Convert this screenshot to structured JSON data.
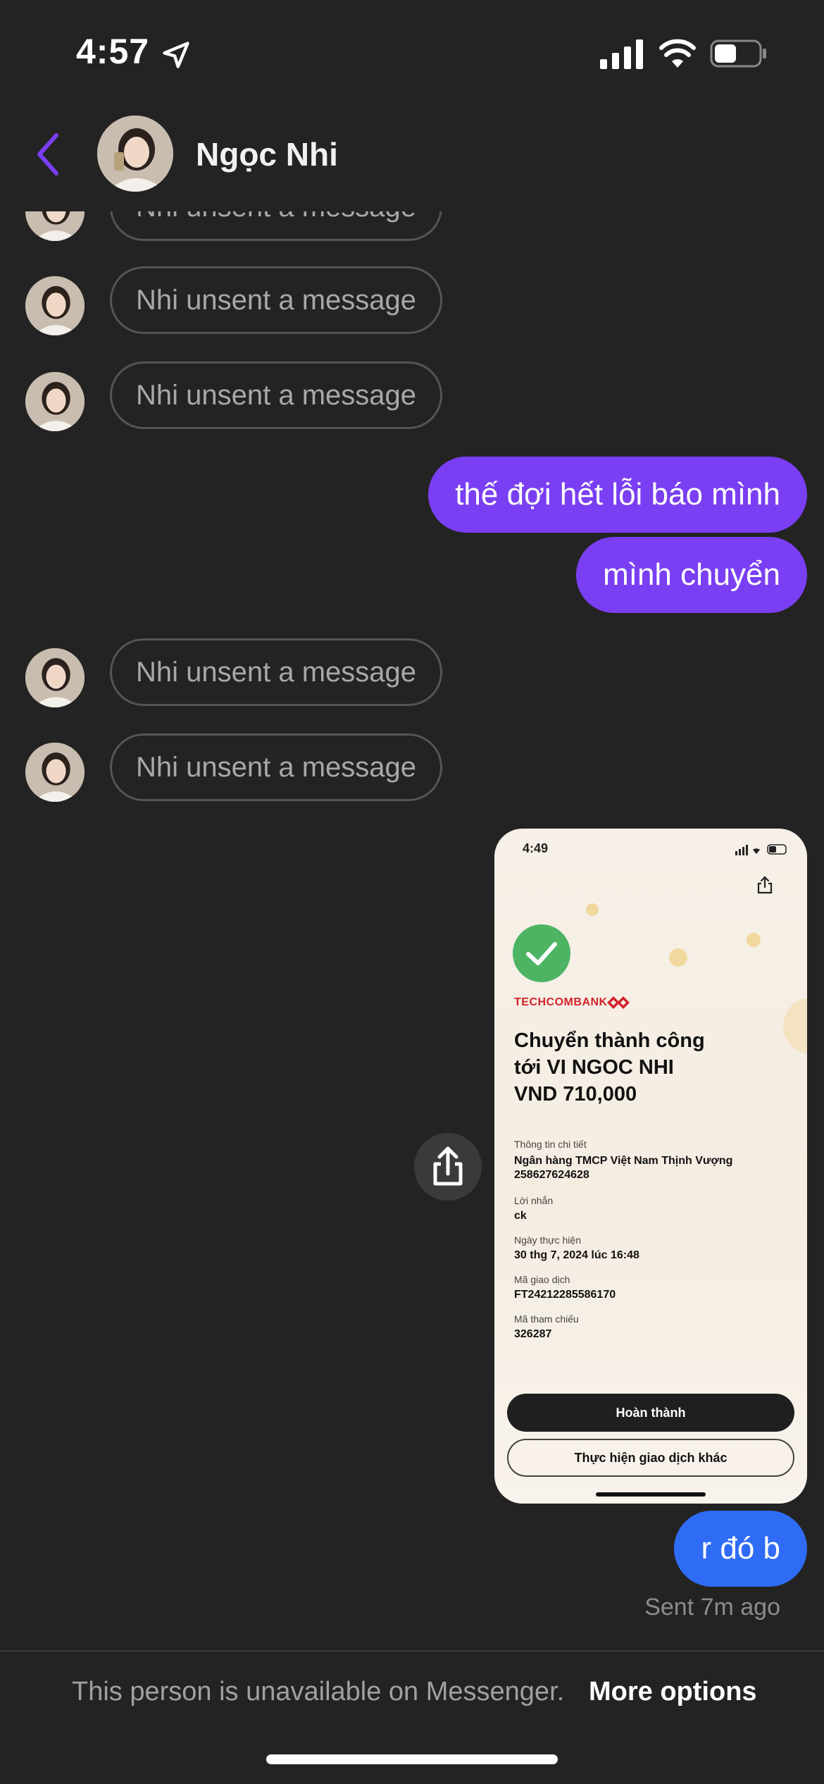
{
  "status_bar": {
    "time": "4:57"
  },
  "header": {
    "contact_name": "Ngọc Nhi"
  },
  "messages": {
    "unsent_text": "Nhi unsent a message",
    "outgoing_1": "thế đợi hết lỗi báo mình",
    "outgoing_2": "mình chuyển",
    "outgoing_3": "r đó b",
    "sent_status": "Sent 7m ago"
  },
  "receipt": {
    "time": "4:49",
    "bank": "TECHCOMBANK",
    "title_line1": "Chuyển thành công",
    "title_line2": "tới VI NGOC NHI",
    "title_line3": "VND 710,000",
    "detail_label": "Thông tin chi tiết",
    "bank_name": "Ngân hàng TMCP Việt Nam Thịnh Vượng",
    "account": "258627624628",
    "message_label": "Lời nhắn",
    "message_value": "ck",
    "date_label": "Ngày thực hiện",
    "date_value": "30 thg 7, 2024 lúc 16:48",
    "txn_label": "Mã giao dịch",
    "txn_value": "FT24212285586170",
    "ref_label": "Mã tham chiếu",
    "ref_value": "326287",
    "btn_done": "Hoàn thành",
    "btn_other": "Thực hiện giao dịch khác"
  },
  "footer": {
    "unavailable_text": "This person is unavailable on Messenger.",
    "more_options": "More options"
  },
  "colors": {
    "background": "#232323",
    "outgoing_bubble": "#7a3ff2",
    "last_bubble": "#2f6cf6",
    "accent_back": "#7a3ff2"
  },
  "icons": [
    "location-arrow-icon",
    "signal-icon",
    "wifi-icon",
    "battery-icon",
    "back-chevron-icon",
    "share-icon",
    "checkmark-icon"
  ]
}
